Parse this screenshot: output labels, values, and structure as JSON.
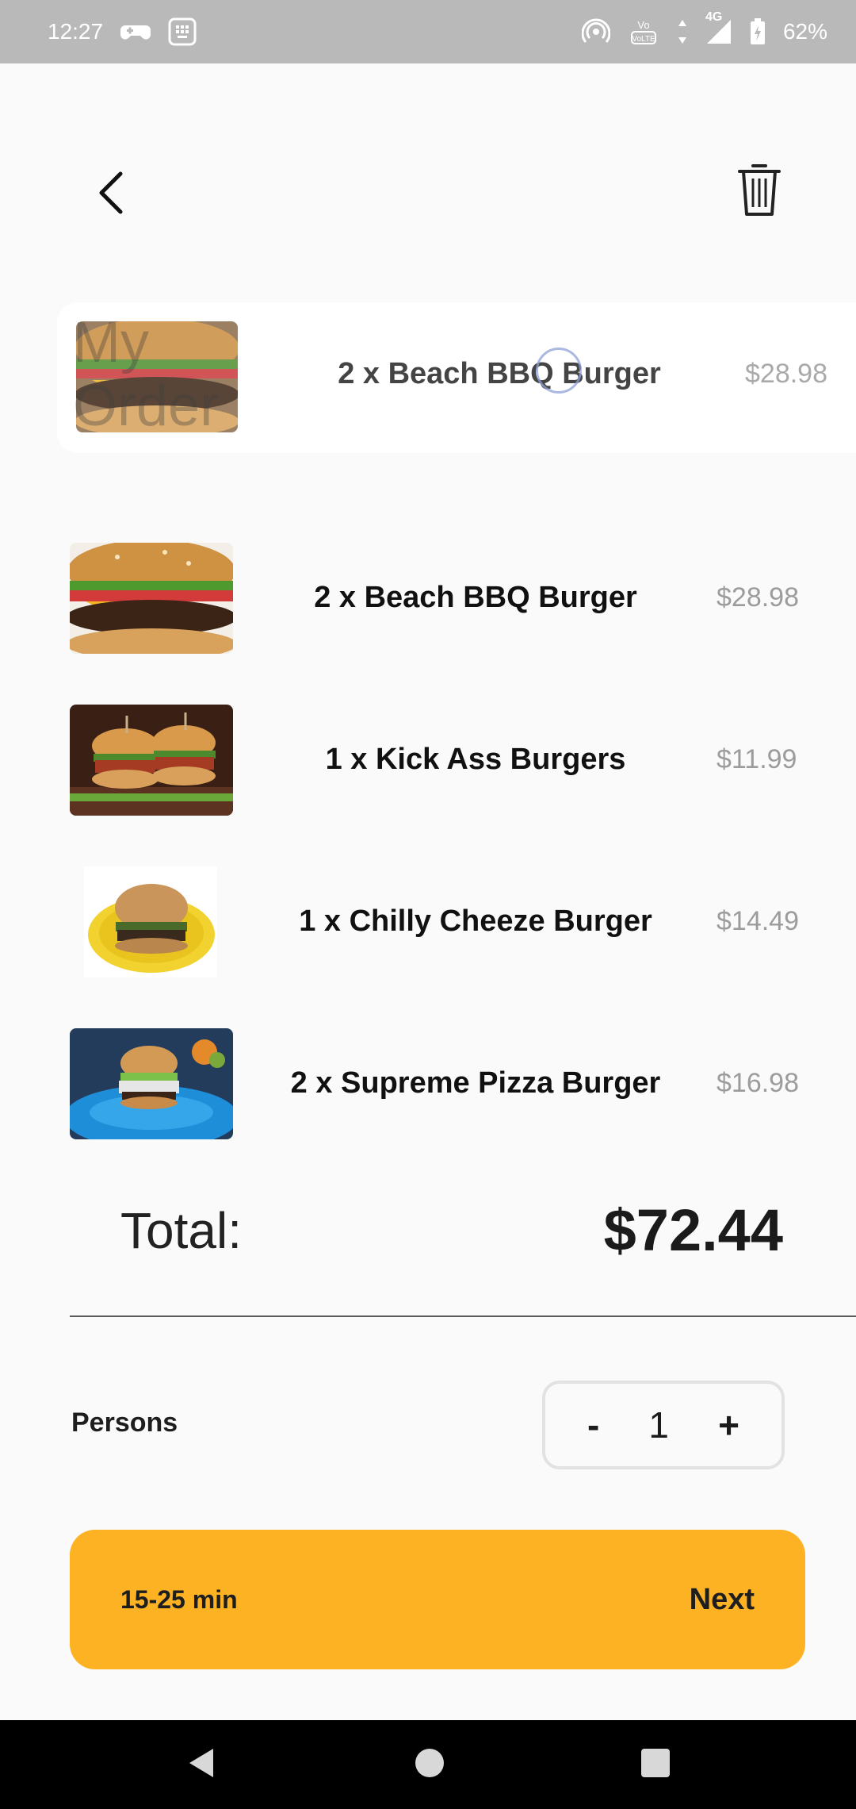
{
  "status_bar": {
    "time": "12:27",
    "network": "4G",
    "volte": "VoLTE",
    "battery": "62%",
    "icons_left": [
      "game-controller-icon",
      "keyboard-icon"
    ],
    "icons_right": [
      "hotspot-icon",
      "volte-icon",
      "data-arrows-icon",
      "signal-icon",
      "battery-icon"
    ]
  },
  "header": {
    "back_icon": "chevron-left-icon",
    "trash_icon": "trash-icon"
  },
  "dragging": {
    "ghost_title": "My Order",
    "name": "2 x Beach BBQ Burger",
    "price": "$28.98"
  },
  "order": {
    "items": [
      {
        "name": "2 x Beach BBQ Burger",
        "price": "$28.98",
        "image": "burger-photo"
      },
      {
        "name": "1 x Kick Ass Burgers",
        "price": "$11.99",
        "image": "sliders-photo"
      },
      {
        "name": "1 x Chilly Cheeze Burger",
        "price": "$14.49",
        "image": "plate-burger-photo"
      },
      {
        "name": "2 x Supreme Pizza Burger",
        "price": "$16.98",
        "image": "blue-plate-burger-photo"
      }
    ]
  },
  "total": {
    "label": "Total:",
    "value": "$72.44"
  },
  "persons": {
    "label": "Persons",
    "minus": "-",
    "count": "1",
    "plus": "+"
  },
  "footer": {
    "eta": "15-25 min",
    "next_label": "Next",
    "accent_color": "#fdb224"
  },
  "nav": {
    "back": "nav-back-icon",
    "home": "nav-home-icon",
    "recents": "nav-recents-icon"
  }
}
